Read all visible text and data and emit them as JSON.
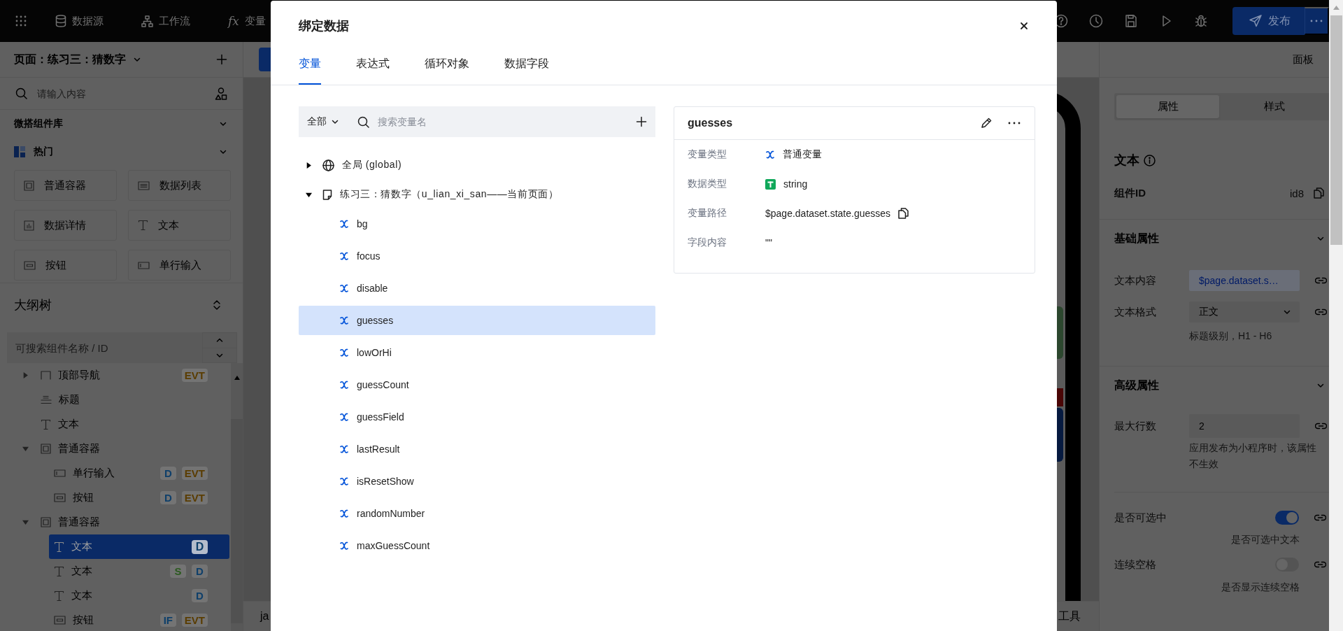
{
  "topbar": {
    "nav": [
      {
        "kind": "datasource",
        "label": "数据源"
      },
      {
        "kind": "workflow",
        "label": "工作流"
      },
      {
        "kind": "variable",
        "symbol": "fx",
        "label": "变量"
      }
    ],
    "publish": {
      "label": "发布"
    }
  },
  "left": {
    "page_title": "页面：练习三：猜数字",
    "search": {
      "placeholder": "请输入内容"
    },
    "library": {
      "title": "微搭组件库",
      "group": "热门",
      "components": [
        {
          "kind": "container",
          "label": "普通容器"
        },
        {
          "kind": "list",
          "label": "数据列表"
        },
        {
          "kind": "detail",
          "label": "数据详情"
        },
        {
          "kind": "text",
          "label": "文本"
        },
        {
          "kind": "button",
          "label": "按钮"
        },
        {
          "kind": "input",
          "label": "单行输入"
        }
      ]
    },
    "outline": {
      "title": "大纲树",
      "search": {
        "placeholder": "可搜索组件名称 / ID"
      },
      "tree": [
        {
          "kind": "nav",
          "label": "顶部导航",
          "expanded": false,
          "selected": false,
          "badges": [
            {
              "text": "EVT",
              "color": "#5a3c00"
            }
          ]
        },
        {
          "kind": "title",
          "label": "标题",
          "selected": false
        },
        {
          "kind": "text",
          "label": "文本",
          "selected": false
        },
        {
          "kind": "container",
          "label": "普通容器",
          "expanded": true,
          "selected": false,
          "children": [
            {
              "kind": "input",
              "label": "单行输入",
              "selected": false,
              "badges": [
                {
                  "text": "D",
                  "color": "#0e3f6a"
                },
                {
                  "text": "EVT",
                  "color": "#5a3c00"
                }
              ]
            },
            {
              "kind": "button",
              "label": "按钮",
              "selected": false,
              "badges": [
                {
                  "text": "D",
                  "color": "#0e3f6a"
                },
                {
                  "text": "EVT",
                  "color": "#5a3c00"
                }
              ]
            }
          ]
        },
        {
          "kind": "container",
          "label": "普通容器",
          "expanded": true,
          "selected": false,
          "children": [
            {
              "kind": "text",
              "label": "文本",
              "selected": true,
              "badges": [
                {
                  "text": "D",
                  "color": "#0e3f6a"
                }
              ]
            },
            {
              "kind": "text",
              "label": "文本",
              "selected": false,
              "badges": [
                {
                  "text": "S",
                  "color": "#2a5a1e"
                },
                {
                  "text": "D",
                  "color": "#0e3f6a"
                }
              ]
            },
            {
              "kind": "text",
              "label": "文本",
              "selected": false,
              "badges": [
                {
                  "text": "D",
                  "color": "#0e3f6a"
                }
              ]
            },
            {
              "kind": "button",
              "label": "按钮",
              "selected": false,
              "badges": [
                {
                  "text": "IF",
                  "color": "#0e3f6a"
                },
                {
                  "text": "EVT",
                  "color": "#5a3c00"
                }
              ]
            }
          ]
        }
      ]
    }
  },
  "canvas": {
    "status_left": "ja",
    "status_right": "工具"
  },
  "right": {
    "panel_label": "面板",
    "tabs": [
      {
        "label": "属性",
        "selected": true
      },
      {
        "label": "样式",
        "selected": false
      }
    ],
    "component": {
      "title": "文本",
      "id_label": "组件ID",
      "id": "id8"
    },
    "sections": [
      {
        "title": "基础属性",
        "rows": [
          {
            "kind": "input",
            "label": "文本内容",
            "value": "$page.dataset.s…",
            "bound": true
          },
          {
            "kind": "select",
            "label": "文本格式",
            "value": "正文",
            "hint": "标题级别，H1 - H6"
          }
        ]
      },
      {
        "title": "高级属性",
        "rows": [
          {
            "kind": "input",
            "label": "最大行数",
            "value": "2",
            "bound": false,
            "hint": "应用发布为小程序时，该属性不生效"
          },
          {
            "kind": "switch",
            "label": "是否可选中",
            "on": true,
            "hint": "是否可选中文本"
          },
          {
            "kind": "switch",
            "label": "连续空格",
            "on": false,
            "hint": "是否显示连续空格"
          }
        ]
      }
    ]
  },
  "modal": {
    "title": "绑定数据",
    "tabs": [
      {
        "label": "变量",
        "selected": true
      },
      {
        "label": "表达式",
        "selected": false
      },
      {
        "label": "循环对象",
        "selected": false
      },
      {
        "label": "数据字段",
        "selected": false
      }
    ],
    "filter": {
      "label": "全部"
    },
    "search": {
      "placeholder": "搜索变量名"
    },
    "tree": [
      {
        "kind": "global",
        "label": "全局 (global)",
        "expanded": false,
        "selected": false
      },
      {
        "kind": "page",
        "label": "练习三：猜数字（u_lian_xi_san——当前页面）",
        "expanded": true,
        "selected": false,
        "children": [
          {
            "label": "bg",
            "selected": false
          },
          {
            "label": "focus",
            "selected": false
          },
          {
            "label": "disable",
            "selected": false
          },
          {
            "label": "guesses",
            "selected": true
          },
          {
            "label": "lowOrHi",
            "selected": false
          },
          {
            "label": "guessCount",
            "selected": false
          },
          {
            "label": "guessField",
            "selected": false
          },
          {
            "label": "lastResult",
            "selected": false
          },
          {
            "label": "isResetShow",
            "selected": false
          },
          {
            "label": "randomNumber",
            "selected": false
          },
          {
            "label": "maxGuessCount",
            "selected": false
          }
        ]
      }
    ],
    "detail": {
      "name": "guesses",
      "fields": [
        {
          "kind": "variable",
          "label": "变量类型",
          "value": "普通变量"
        },
        {
          "kind": "string",
          "label": "数据类型",
          "value": "string"
        },
        {
          "kind": "path",
          "label": "变量路径",
          "value": "$page.dataset.state.guesses"
        },
        {
          "kind": "plain",
          "label": "字段内容",
          "value": "\"\""
        }
      ]
    }
  }
}
